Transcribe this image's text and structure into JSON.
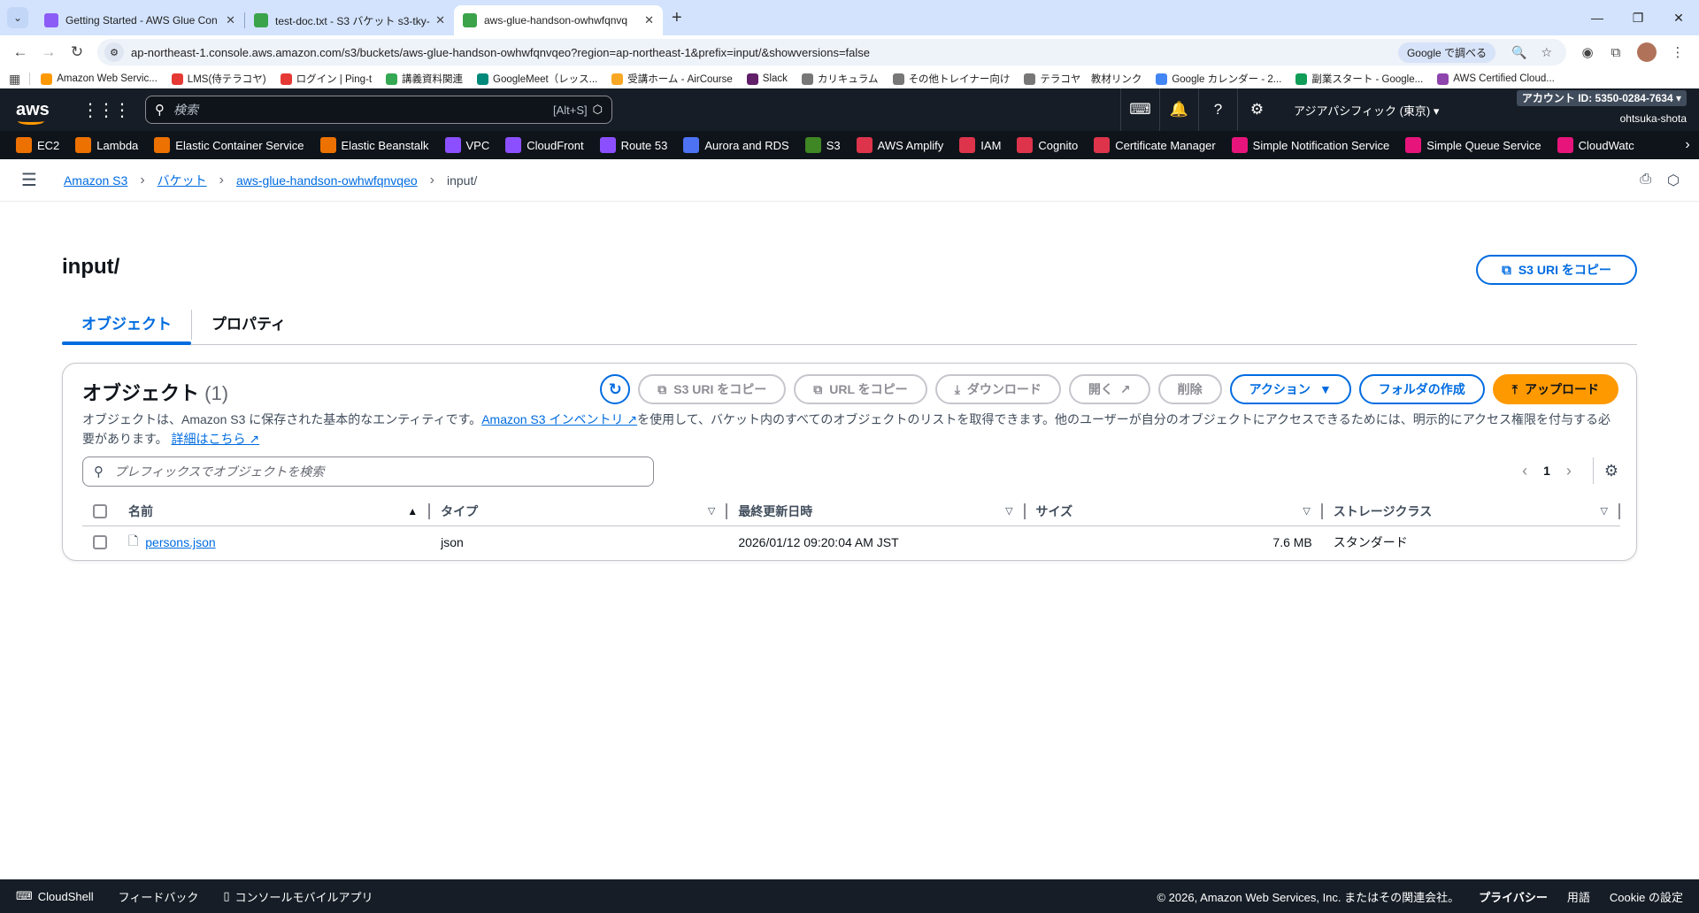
{
  "browser": {
    "tabs": [
      {
        "title": "Getting Started - AWS Glue Con",
        "color": "#8b5cf6",
        "active": false
      },
      {
        "title": "test-doc.txt - S3 バケット s3-tky-",
        "color": "#3ba34a",
        "active": false
      },
      {
        "title": "aws-glue-handson-owhwfqnvq",
        "color": "#3ba34a",
        "active": true
      }
    ],
    "url": "ap-northeast-1.console.aws.amazon.com/s3/buckets/aws-glue-handson-owhwfqnvqeo?region=ap-northeast-1&prefix=input/&showversions=false",
    "google_pill": "Google で調べる",
    "bookmarks": [
      {
        "label": "Amazon Web Servic...",
        "color": "#ff9900"
      },
      {
        "label": "LMS(侍テラコヤ)",
        "color": "#e53935"
      },
      {
        "label": "ログイン | Ping-t",
        "color": "#e53935"
      },
      {
        "label": "講義資料関連",
        "color": "#34a853"
      },
      {
        "label": "GoogleMeet（レッス...",
        "color": "#00897b"
      },
      {
        "label": "受講ホーム - AirCourse",
        "color": "#f9a825"
      },
      {
        "label": "Slack",
        "color": "#611f69"
      },
      {
        "label": "カリキュラム",
        "color": "#777777"
      },
      {
        "label": "その他トレイナー向け",
        "color": "#777777"
      },
      {
        "label": "テラコヤ　教材リンク",
        "color": "#777777"
      },
      {
        "label": "Google カレンダー - 2...",
        "color": "#4285f4"
      },
      {
        "label": "副業スタート - Google...",
        "color": "#0f9d58"
      },
      {
        "label": "AWS Certified Cloud...",
        "color": "#8e44ad"
      }
    ]
  },
  "aws": {
    "search_placeholder": "検索",
    "search_hint": "[Alt+S]",
    "region": "アジアパシフィック (東京)",
    "account_id": "アカウント ID: 5350-0284-7634",
    "user": "ohtsuka-shota",
    "services": [
      {
        "label": "EC2",
        "color": "#ed7100"
      },
      {
        "label": "Lambda",
        "color": "#ed7100"
      },
      {
        "label": "Elastic Container Service",
        "color": "#ed7100"
      },
      {
        "label": "Elastic Beanstalk",
        "color": "#ed7100"
      },
      {
        "label": "VPC",
        "color": "#8c4fff"
      },
      {
        "label": "CloudFront",
        "color": "#8c4fff"
      },
      {
        "label": "Route 53",
        "color": "#8c4fff"
      },
      {
        "label": "Aurora and RDS",
        "color": "#4d72f3"
      },
      {
        "label": "S3",
        "color": "#3f8624"
      },
      {
        "label": "AWS Amplify",
        "color": "#dd344c"
      },
      {
        "label": "IAM",
        "color": "#dd344c"
      },
      {
        "label": "Cognito",
        "color": "#dd344c"
      },
      {
        "label": "Certificate Manager",
        "color": "#dd344c"
      },
      {
        "label": "Simple Notification Service",
        "color": "#e7157b"
      },
      {
        "label": "Simple Queue Service",
        "color": "#e7157b"
      },
      {
        "label": "CloudWatc",
        "color": "#e7157b"
      }
    ]
  },
  "breadcrumb": {
    "items": [
      "Amazon S3",
      "バケット",
      "aws-glue-handson-owhwfqnvqeo"
    ],
    "current": "input/"
  },
  "page": {
    "title": "input/",
    "copy_uri": "S3 URI をコピー",
    "tabs": [
      "オブジェクト",
      "プロパティ"
    ]
  },
  "objects": {
    "title": "オブジェクト",
    "count": "(1)",
    "buttons": {
      "copy_s3_uri": "S3 URI をコピー",
      "copy_url": "URL をコピー",
      "download": "ダウンロード",
      "open": "開く",
      "delete": "削除",
      "actions": "アクション",
      "create_folder": "フォルダの作成",
      "upload": "アップロード"
    },
    "desc_1": "オブジェクトは、Amazon S3 に保存された基本的なエンティティです。",
    "desc_link": "Amazon S3 インベントリ",
    "desc_2": "を使用して、バケット内のすべてのオブジェクトのリストを取得できます。他のユーザーが自分のオブジェクトにアクセスできるためには、明示的にアクセス権限を付与する必要があります。",
    "desc_more": "詳細はこちら",
    "filter_placeholder": "プレフィックスでオブジェクトを検索",
    "page_number": "1",
    "columns": [
      "名前",
      "タイプ",
      "最終更新日時",
      "サイズ",
      "ストレージクラス"
    ],
    "rows": [
      {
        "name": "persons.json",
        "type": "json",
        "modified": "2026/01/12 09:20:04 AM JST",
        "size": "7.6 MB",
        "storage_class": "スタンダード"
      }
    ]
  },
  "footer": {
    "cloudshell": "CloudShell",
    "feedback": "フィードバック",
    "mobile_app": "コンソールモバイルアプリ",
    "copyright": "© 2026, Amazon Web Services, Inc. またはその関連会社。",
    "privacy": "プライバシー",
    "terms": "用語",
    "cookie": "Cookie の設定"
  }
}
